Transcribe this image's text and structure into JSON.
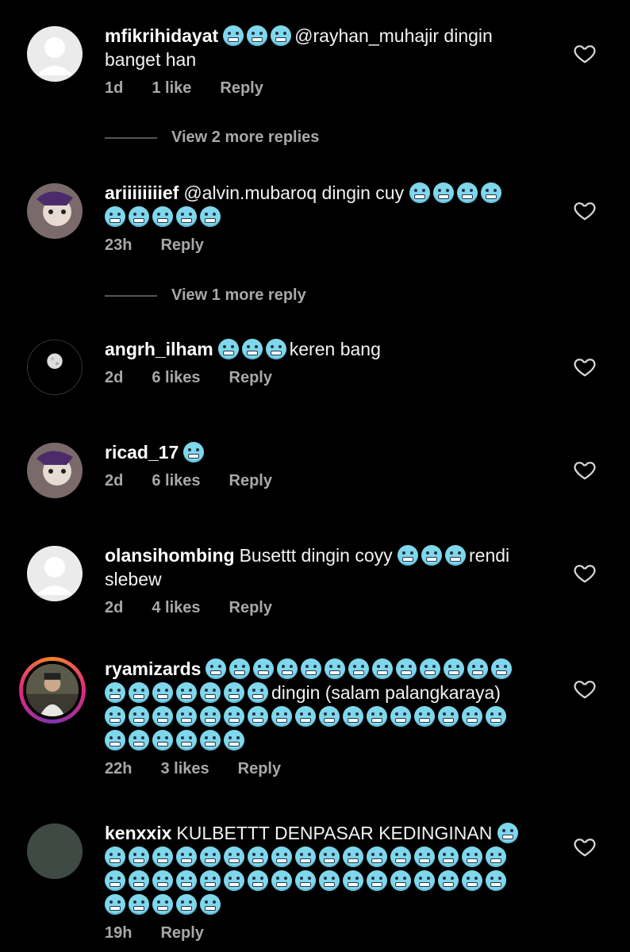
{
  "comments": [
    {
      "username": "mfikrihidayat",
      "emoji_before": 3,
      "text": "@rayhan_muhajir dingin banget han",
      "emoji_after": 0,
      "time": "1d",
      "likes": "1 like",
      "reply": "Reply",
      "avatar": "default-avatar"
    },
    {
      "username": "ariiiiiiiief",
      "emoji_before": 0,
      "text": "@alvin.mubaroq dingin cuy",
      "emoji_after": 9,
      "time": "23h",
      "likes": "",
      "reply": "Reply",
      "avatar": "photo-avatar"
    },
    {
      "username": "angrh_ilham",
      "emoji_before": 3,
      "text": "keren bang",
      "emoji_after": 0,
      "time": "2d",
      "likes": "6 likes",
      "reply": "Reply",
      "avatar": "moon-avatar"
    },
    {
      "username": "ricad_17",
      "emoji_before": 1,
      "text": "",
      "emoji_after": 0,
      "time": "2d",
      "likes": "6 likes",
      "reply": "Reply",
      "avatar": "photo-avatar"
    },
    {
      "username": "olansihombing",
      "emoji_before": 0,
      "text": "Busettt dingin coyy",
      "emoji_after": 3,
      "text2": "rendi slebew",
      "time": "2d",
      "likes": "4 likes",
      "reply": "Reply",
      "avatar": "default-avatar"
    },
    {
      "username": "ryamizards",
      "emoji_before": 20,
      "text": "dingin (salam palangkaraya)",
      "emoji_after": 23,
      "time": "22h",
      "likes": "3 likes",
      "reply": "Reply",
      "avatar": "story-ring-avatar"
    },
    {
      "username": "kenxxix",
      "emoji_before": 0,
      "text": "KULBETTT DENPASAR KEDINGINAN",
      "emoji_after": 40,
      "time": "19h",
      "likes": "",
      "reply": "Reply",
      "avatar": "gray-avatar"
    }
  ],
  "view_more": [
    {
      "label": "View 2 more replies"
    },
    {
      "label": "View 1 more reply"
    }
  ],
  "colors": {
    "background": "#000000",
    "emoji": "#7fd7ec",
    "meta": "#a8a8a8"
  },
  "icons": {
    "emoji": "cold-face-emoji",
    "like": "heart-outline-icon"
  }
}
